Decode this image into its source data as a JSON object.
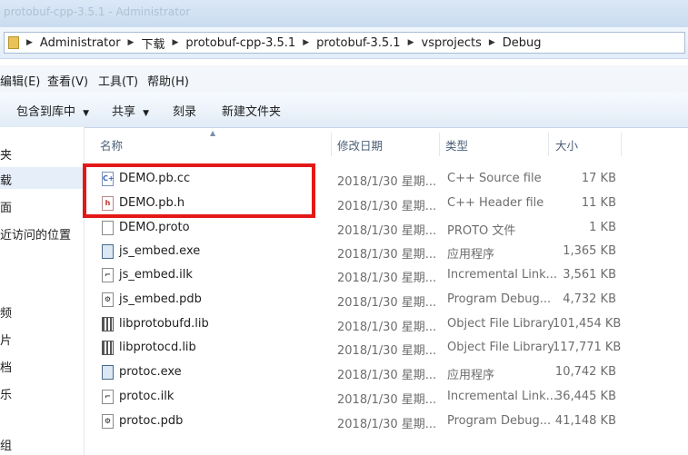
{
  "window": {
    "title": "protobuf-cpp-3.5.1 - Administrator"
  },
  "address": {
    "crumbs": [
      "Administrator",
      "下载",
      "protobuf-cpp-3.5.1",
      "protobuf-3.5.1",
      "vsprojects",
      "Debug"
    ]
  },
  "menu": [
    "编辑(E)",
    "查看(V)",
    "工具(T)",
    "帮助(H)"
  ],
  "toolbar": {
    "include_library": "包含到库中",
    "share": "共享",
    "burn": "刻录",
    "new_folder": "新建文件夹"
  },
  "sidebar": [
    "夹",
    "载",
    "面",
    "近访问的位置",
    "频",
    "片",
    "档",
    "乐",
    "组"
  ],
  "columns": {
    "name": "名称",
    "date": "修改日期",
    "type": "类型",
    "size": "大小"
  },
  "files": [
    {
      "name": "DEMO.pb.cc",
      "date": "2018/1/30 星期...",
      "type": "C++ Source file",
      "size": "17 KB",
      "icon": "cpp-source-icon"
    },
    {
      "name": "DEMO.pb.h",
      "date": "2018/1/30 星期...",
      "type": "C++ Header file",
      "size": "11 KB",
      "icon": "cpp-header-icon"
    },
    {
      "name": "DEMO.proto",
      "date": "2018/1/30 星期...",
      "type": "PROTO 文件",
      "size": "1 KB",
      "icon": "blank-file-icon"
    },
    {
      "name": "js_embed.exe",
      "date": "2018/1/30 星期...",
      "type": "应用程序",
      "size": "1,365 KB",
      "icon": "exe-icon"
    },
    {
      "name": "js_embed.ilk",
      "date": "2018/1/30 星期...",
      "type": "Incremental Link...",
      "size": "3,561 KB",
      "icon": "ilk-file-icon"
    },
    {
      "name": "js_embed.pdb",
      "date": "2018/1/30 星期...",
      "type": "Program Debug...",
      "size": "4,732 KB",
      "icon": "pdb-file-icon"
    },
    {
      "name": "libprotobufd.lib",
      "date": "2018/1/30 星期...",
      "type": "Object File Library",
      "size": "101,454 KB",
      "icon": "lib-file-icon"
    },
    {
      "name": "libprotocd.lib",
      "date": "2018/1/30 星期...",
      "type": "Object File Library",
      "size": "117,771 KB",
      "icon": "lib-file-icon"
    },
    {
      "name": "protoc.exe",
      "date": "2018/1/30 星期...",
      "type": "应用程序",
      "size": "10,742 KB",
      "icon": "exe-icon"
    },
    {
      "name": "protoc.ilk",
      "date": "2018/1/30 星期...",
      "type": "Incremental Link...",
      "size": "36,445 KB",
      "icon": "ilk-file-icon"
    },
    {
      "name": "protoc.pdb",
      "date": "2018/1/30 星期...",
      "type": "Program Debug...",
      "size": "41,148 KB",
      "icon": "pdb-file-icon"
    }
  ],
  "highlight_color": "#e31818"
}
